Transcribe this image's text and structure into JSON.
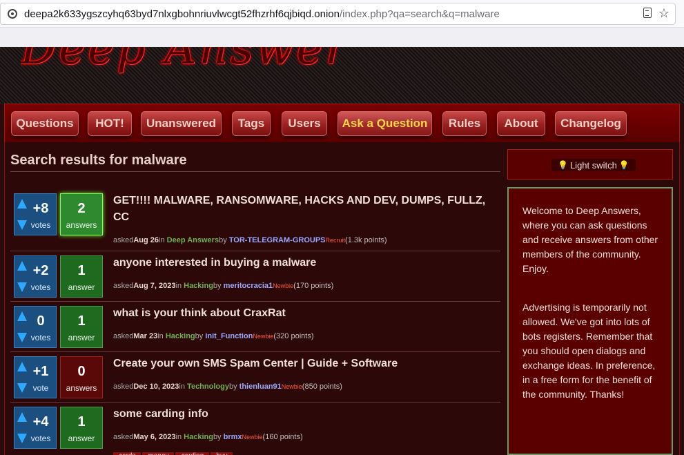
{
  "browser": {
    "url_host": "deepa2k633ygszcyhq63byd7nlxgbohnriuvlwcgt52fhzrhf6qjbiqd.onion",
    "url_path": "/index.php?qa=search&q=malware"
  },
  "site": {
    "logo_text": "Deep Answers"
  },
  "nav": {
    "items": [
      "Questions",
      "HOT!",
      "Unanswered",
      "Tags",
      "Users",
      "Ask a Question",
      "Rules",
      "About",
      "Changelog"
    ],
    "selected": "Ask a Question"
  },
  "page_title": "Search results for malware",
  "questions": [
    {
      "votes": "+8",
      "votes_label": "votes",
      "answers": "2",
      "answers_label": "answers",
      "title": "GET!!!! MALWARE, RANSOMWARE, HACKS AND DEV, DUMPS, FULLZ, CC",
      "asked": "asked",
      "date": "Aug 26",
      "in": "in",
      "category": "Deep Answers",
      "by": "by",
      "user": "TOR-TELEGRAM-GROUPS",
      "level": "Recruit",
      "points": "(1.3k points)"
    },
    {
      "votes": "+2",
      "votes_label": "votes",
      "answers": "1",
      "answers_label": "answer",
      "title": "anyone interested in buying a malware",
      "asked": "asked",
      "date": "Aug 7, 2023",
      "in": "in",
      "category": "Hacking",
      "by": "by",
      "user": "meritocracia1",
      "level": "Newbie",
      "points": "(170 points)"
    },
    {
      "votes": "0",
      "votes_label": "votes",
      "answers": "1",
      "answers_label": "answer",
      "title": "what is your think about CraxRat",
      "asked": "asked",
      "date": "Mar 23",
      "in": "in",
      "category": "Hacking",
      "by": "by",
      "user": "init_Function",
      "level": "Newbie",
      "points": "(320 points)"
    },
    {
      "votes": "+1",
      "votes_label": "vote",
      "answers": "0",
      "answers_label": "answers",
      "title": "Create your own SMS Spam Center | Guide + Software",
      "asked": "asked",
      "date": "Dec 10, 2023",
      "in": "in",
      "category": "Technology",
      "by": "by",
      "user": "thienluan91",
      "level": "Newbie",
      "points": "(850 points)"
    },
    {
      "votes": "+4",
      "votes_label": "votes",
      "answers": "1",
      "answers_label": "answer",
      "title": "some carding info",
      "asked": "asked",
      "date": "May 6, 2023",
      "in": "in",
      "category": "Hacking",
      "by": "by",
      "user": "brmx",
      "level": "Newbie",
      "points": "(160 points)",
      "tags": [
        "cards",
        "money",
        "carding",
        "buy"
      ]
    }
  ],
  "sidebar": {
    "light_switch": "Light switch",
    "welcome": "Welcome to Deep Answers, where you can ask questions and receive answers from other members of the community. Enjoy.",
    "notice": "Advertising is temporarily not allowed. We've got into lots of bots registers. Remember that you should open dialogs and exchange ideas. In preference, in a free form for the benefit of the community. Thanks!"
  }
}
